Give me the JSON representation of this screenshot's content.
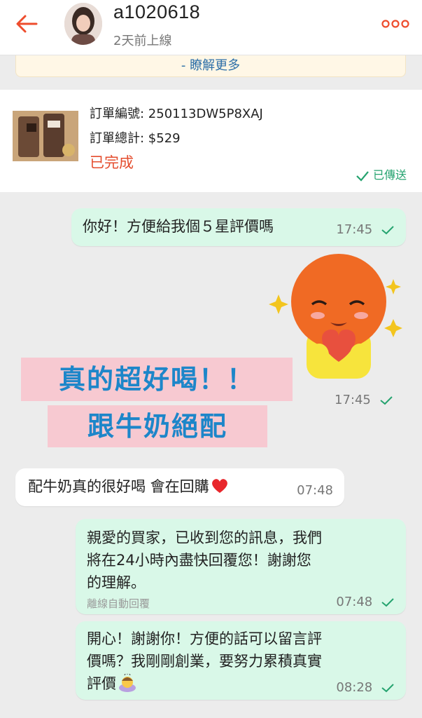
{
  "header": {
    "username": "a1020618",
    "status": "2天前上線"
  },
  "notice": {
    "link": "- 瞭解更多"
  },
  "order": {
    "number_label": "訂單編號: 250113DW5P8XAJ",
    "total_label": "訂單總計: $529",
    "status": "已完成",
    "sent": "已傳送"
  },
  "messages": [
    {
      "text": "你好！方便給我個５星評價嗎",
      "time": "17:45"
    },
    {
      "text": "",
      "time": "17:45"
    },
    {
      "text": "配牛奶真的很好喝 會在回購",
      "time": "07:48"
    },
    {
      "line1": "親愛的買家，已收到您的訊息，我們",
      "line2": "將在24小時內盡快回覆您！謝謝您",
      "line3": "的理解。",
      "note": "離線自動回覆",
      "time": "07:48"
    },
    {
      "line1": "開心！謝謝你！方便的話可以留言評",
      "line2": "價嗎？我剛剛創業，要努力累積真實",
      "line3": "評價",
      "time": "08:28"
    }
  ],
  "promo": {
    "line1": "真的超好喝！！",
    "line2": "跟牛奶絕配"
  },
  "colors": {
    "accent": "#ee4d2d",
    "outgoing_bubble": "#d9f8e8",
    "check": "#25a36f",
    "promo_text": "#1d86c9",
    "promo_bg": "#f7c9d1"
  }
}
